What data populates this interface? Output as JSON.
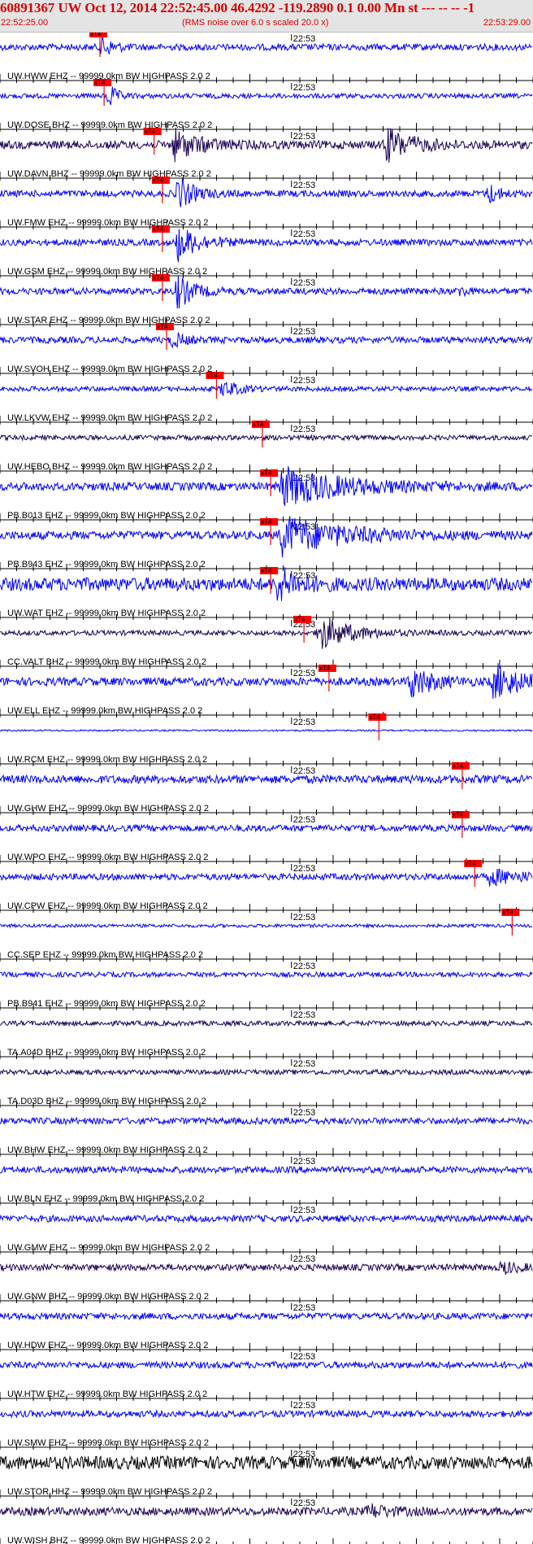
{
  "header": {
    "title": "60891367 UW Oct 12, 2014 22:52:45.00   46.4292 -119.2890  0.1 0.00 Mn st --- -- --   -1",
    "start_time": "22:52:25.00",
    "end_time": "22:53:29.00",
    "subtitle": "(RMS noise over 6.0 s scaled 20.0 x)"
  },
  "colors": {
    "trace_blue": "#0000ff",
    "trace_dark": "#1a0055",
    "trace_black": "#000000",
    "pick": "#ff0000"
  },
  "chart_data": {
    "type": "line",
    "x_unit": "time (UTC)",
    "x_range": [
      "22:52:25.00",
      "22:53:29.00"
    ],
    "time_tick_label": "22:53",
    "pick_label": "xT4",
    "series": [
      {
        "label": "UW.HWW EHZ -- 99999.0km BW  HIGHPASS  2.0  2",
        "color": "blue",
        "pick_s": 12.0,
        "amp": 4,
        "bursts": [
          {
            "t": 12.0,
            "a": 16,
            "d": 2
          }
        ]
      },
      {
        "label": "UW.DOSE BHZ -- 99999.0km BW  HIGHPASS  2.0  2",
        "color": "blue",
        "pick_s": 12.5,
        "amp": 3,
        "bursts": [
          {
            "t": 12.7,
            "a": 22,
            "d": 1.5
          }
        ]
      },
      {
        "label": "UW.DAVN BHZ -- 99999.0km BW  HIGHPASS  2.0  2",
        "color": "dark",
        "pick_s": 18.5,
        "amp": 5,
        "bursts": [
          {
            "t": 20.5,
            "a": 20,
            "d": 5
          },
          {
            "t": 46.0,
            "a": 22,
            "d": 5
          }
        ]
      },
      {
        "label": "UW.FMW EHZ -- 99999.0km BW  HIGHPASS  2.0  2",
        "color": "blue",
        "pick_s": 19.5,
        "amp": 4,
        "bursts": [
          {
            "t": 21.0,
            "a": 24,
            "d": 3
          },
          {
            "t": 58.5,
            "a": 14,
            "d": 2
          }
        ]
      },
      {
        "label": "UW.GSM EHZ -- 99999.0km BW  HIGHPASS  2.0  2",
        "color": "blue",
        "pick_s": 19.5,
        "amp": 4,
        "bursts": [
          {
            "t": 21.0,
            "a": 24,
            "d": 4
          }
        ]
      },
      {
        "label": "UW.STAR EHZ -- 99999.0km BW  HIGHPASS  2.0  2",
        "color": "blue",
        "pick_s": 19.5,
        "amp": 4,
        "bursts": [
          {
            "t": 21.0,
            "a": 24,
            "d": 3
          },
          {
            "t": 55.0,
            "a": 10,
            "d": 1
          }
        ]
      },
      {
        "label": "UW.SVOH EHZ -- 99999.0km BW  HIGHPASS  2.0  2",
        "color": "blue",
        "pick_s": 20.0,
        "amp": 4,
        "bursts": [
          {
            "t": 20.5,
            "a": 12,
            "d": 2
          }
        ]
      },
      {
        "label": "UW.LKVW EHZ -- 99999.0km BW  HIGHPASS  2.0  2",
        "color": "blue",
        "pick_s": 26.0,
        "amp": 3,
        "bursts": [
          {
            "t": 26.5,
            "a": 12,
            "d": 3
          }
        ]
      },
      {
        "label": "UW.HEBO BHZ -- 99999.0km BW  HIGHPASS  2.0  2",
        "color": "dark",
        "pick_s": 31.5,
        "amp": 3,
        "bursts": []
      },
      {
        "label": "PB.B013 EHZ -- 99999.0km BW  HIGHPASS  2.0  2",
        "color": "blue",
        "pick_s": 32.5,
        "amp": 5,
        "bursts": [
          {
            "t": 33.5,
            "a": 24,
            "d": 12
          }
        ]
      },
      {
        "label": "PB.B943 EHZ -- 99999.0km BW  HIGHPASS  2.0  2",
        "color": "blue",
        "pick_s": 32.5,
        "amp": 5,
        "bursts": [
          {
            "t": 33.5,
            "a": 24,
            "d": 12
          }
        ]
      },
      {
        "label": "UW.WAT EHZ -- 99999.0km BW  HIGHPASS  2.0  2",
        "color": "blue",
        "pick_s": 32.5,
        "amp": 8,
        "bursts": [
          {
            "t": 33.0,
            "a": 22,
            "d": 4
          }
        ]
      },
      {
        "label": "CC.VALT BHZ -- 99999.0km BW  HIGHPASS  2.0  2",
        "color": "dark",
        "pick_s": 36.5,
        "amp": 3,
        "bursts": [
          {
            "t": 38.0,
            "a": 24,
            "d": 6
          }
        ]
      },
      {
        "label": "UW.ELL EHZ -- 99999.0km BW  HIGHPASS  2.0  2",
        "color": "blue",
        "pick_s": 39.5,
        "amp": 5,
        "bursts": [
          {
            "t": 49.0,
            "a": 22,
            "d": 4
          },
          {
            "t": 59.0,
            "a": 24,
            "d": 5
          }
        ]
      },
      {
        "label": "UW.RCM EHZ -- 99999.0km BW  HIGHPASS  2.0  2",
        "color": "blue",
        "pick_s": 45.5,
        "amp": 1,
        "bursts": []
      },
      {
        "label": "UW.GHW EHZ -- 99999.0km BW  HIGHPASS  2.0  2",
        "color": "blue",
        "pick_s": 55.5,
        "amp": 5,
        "bursts": []
      },
      {
        "label": "UW.WPO EHZ -- 99999.0km BW  HIGHPASS  2.0  2",
        "color": "blue",
        "pick_s": 55.5,
        "amp": 4,
        "bursts": []
      },
      {
        "label": "UW.CPW EHZ -- 99999.0km BW  HIGHPASS  2.0  2",
        "color": "blue",
        "pick_s": 57.0,
        "amp": 4,
        "bursts": [
          {
            "t": 58.5,
            "a": 10,
            "d": 6
          }
        ]
      },
      {
        "label": "CC.SEP EHZ -- 99999.0km BW  HIGHPASS  2.0  2",
        "color": "blue",
        "pick_s": 61.5,
        "amp": 2,
        "bursts": []
      },
      {
        "label": "PB.B941 EHZ -- 99999.0km BW  HIGHPASS  2.0  2",
        "color": "blue",
        "pick_s": null,
        "amp": 3,
        "bursts": []
      },
      {
        "label": "TA.A04D BHZ -- 99999.0km BW  HIGHPASS  2.0  2",
        "color": "dark",
        "pick_s": null,
        "amp": 3,
        "bursts": []
      },
      {
        "label": "TA.D03D BHZ -- 99999.0km BW  HIGHPASS  2.0  2",
        "color": "dark",
        "pick_s": null,
        "amp": 3,
        "bursts": []
      },
      {
        "label": "UW.BHW EHZ -- 99999.0km BW  HIGHPASS  2.0  2",
        "color": "blue",
        "pick_s": null,
        "amp": 4,
        "bursts": []
      },
      {
        "label": "UW.BLN EHZ -- 99999.0km BW  HIGHPASS  2.0  2",
        "color": "blue",
        "pick_s": null,
        "amp": 4,
        "bursts": []
      },
      {
        "label": "UW.GMW EHZ -- 99999.0km BW  HIGHPASS  2.0  2",
        "color": "blue",
        "pick_s": null,
        "amp": 4,
        "bursts": []
      },
      {
        "label": "UW.GNW BHZ -- 99999.0km BW  HIGHPASS  2.0  2",
        "color": "dark",
        "pick_s": null,
        "amp": 4,
        "bursts": [
          {
            "t": 60.0,
            "a": 8,
            "d": 3
          }
        ]
      },
      {
        "label": "UW.HDW EHZ -- 99999.0km BW  HIGHPASS  2.0  2",
        "color": "blue",
        "pick_s": null,
        "amp": 4,
        "bursts": []
      },
      {
        "label": "UW.HTW EHZ -- 99999.0km BW  HIGHPASS  2.0  2",
        "color": "blue",
        "pick_s": null,
        "amp": 4,
        "bursts": []
      },
      {
        "label": "UW.SMW EHZ -- 99999.0km BW  HIGHPASS  2.0  2",
        "color": "blue",
        "pick_s": null,
        "amp": 4,
        "bursts": []
      },
      {
        "label": "UW.STOR HHZ -- 99999.0km BW  HIGHPASS  2.0  2",
        "color": "black",
        "pick_s": null,
        "amp": 8,
        "bursts": []
      },
      {
        "label": "UW.WISH BHZ -- 99999.0km BW  HIGHPASS  2.0  2",
        "color": "dark",
        "pick_s": null,
        "amp": 5,
        "bursts": [
          {
            "t": 44.0,
            "a": 8,
            "d": 4
          }
        ]
      }
    ]
  }
}
